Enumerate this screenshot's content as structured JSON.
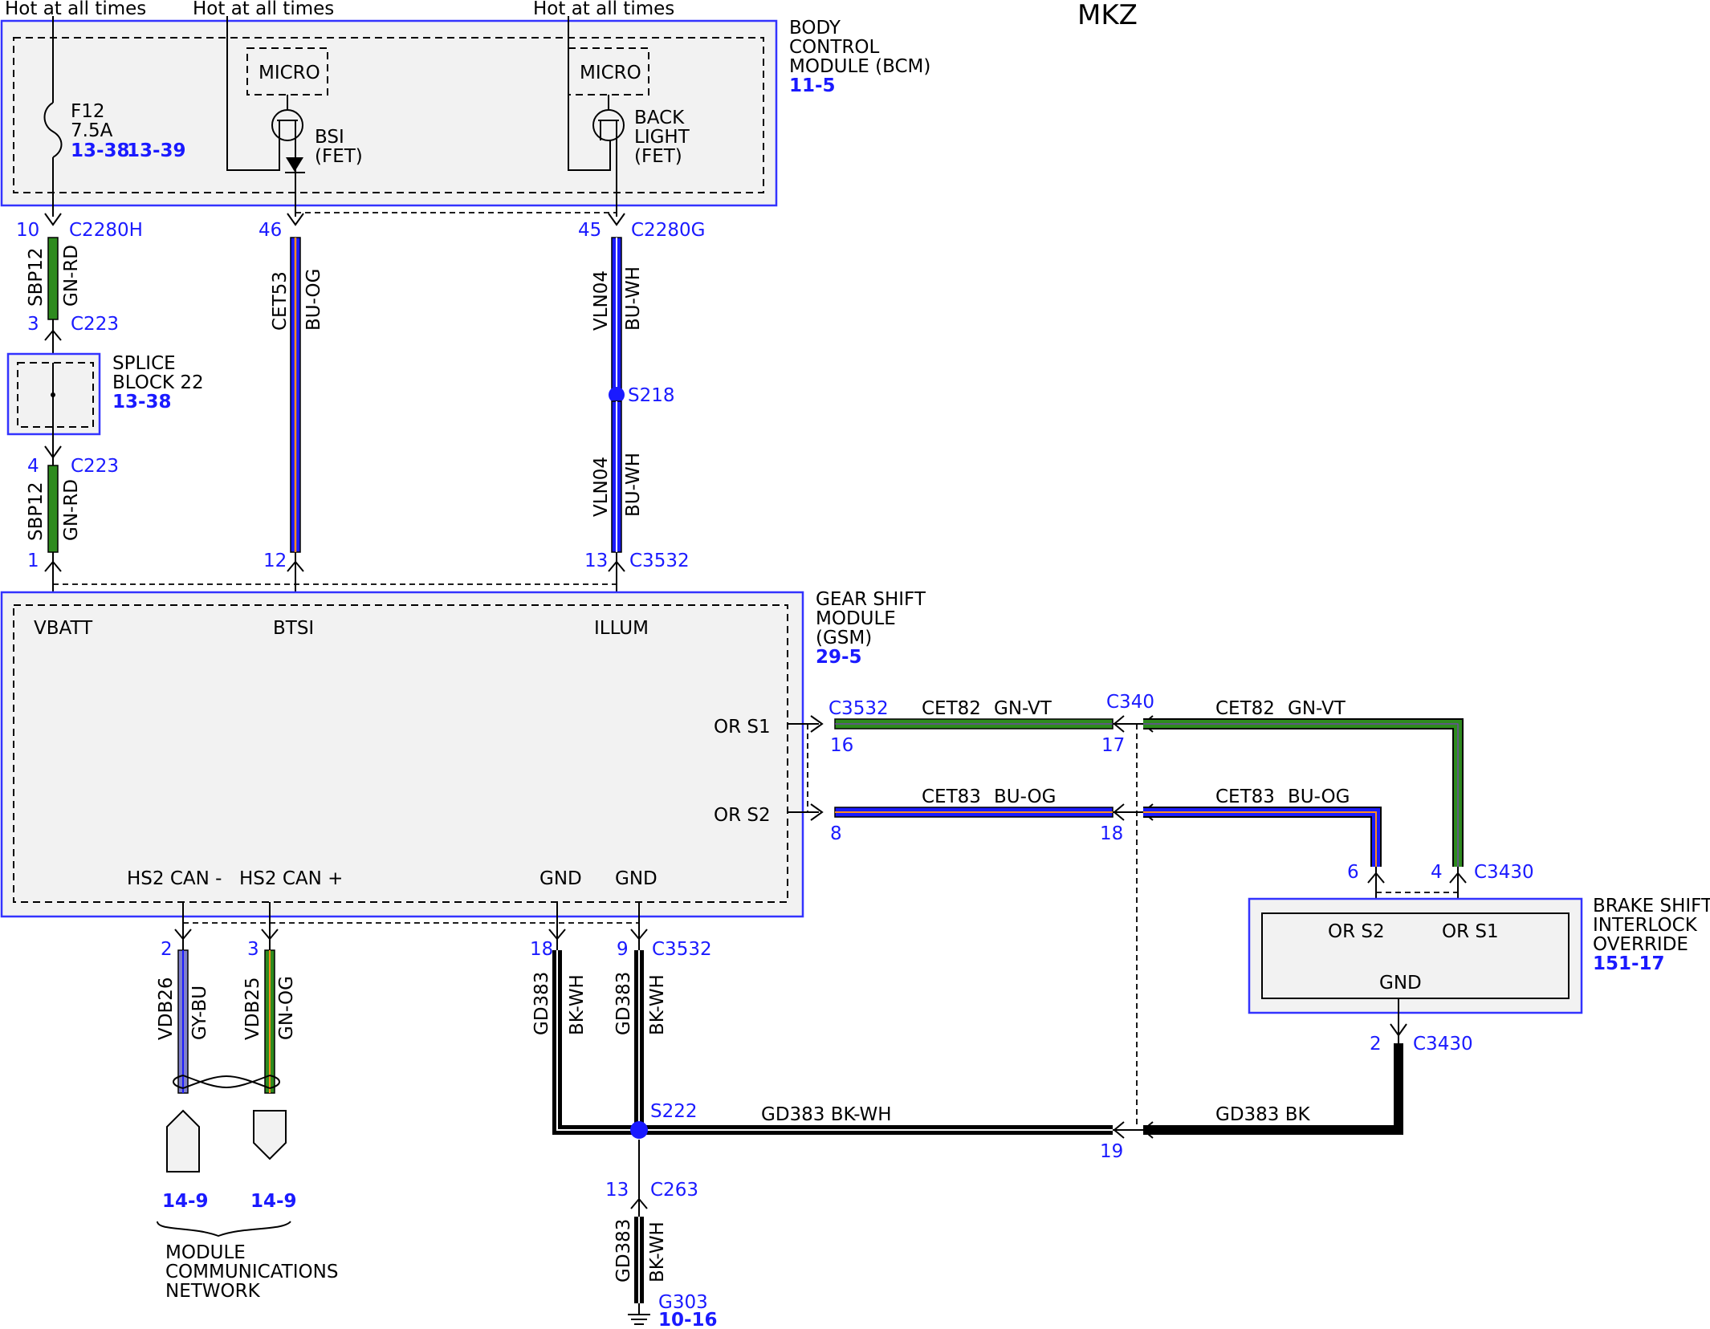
{
  "title": "MKZ",
  "colors": {
    "module_border": "#3333ff",
    "reference_text": "#1a1aff",
    "wire_green": "#2e8b1e",
    "wire_blue": "#1a1aff",
    "wire_gray_blue": "#7f7fc8",
    "wire_black": "#000000",
    "module_fill": "#f2f2f2"
  },
  "power_labels": [
    "Hot at all times",
    "Hot at all times",
    "Hot at all times"
  ],
  "bcm": {
    "name_lines": [
      "BODY",
      "CONTROL",
      "MODULE (BCM)"
    ],
    "ref": "11-5",
    "fuse": {
      "name": "F12",
      "rating": "7.5A",
      "ref1": "13-38",
      "ref2": "13-39"
    },
    "micro1": "MICRO",
    "micro2": "MICRO",
    "bsi": [
      "BSI",
      "(FET)"
    ],
    "backlight": [
      "BACK",
      "LIGHT",
      "(FET)"
    ]
  },
  "connectors": {
    "c2280h": {
      "pin": "10",
      "name": "C2280H"
    },
    "c2280g_46": {
      "pin": "46"
    },
    "c2280g": {
      "pin": "45",
      "name": "C2280G"
    },
    "c223_top": {
      "pin": "3",
      "name": "C223"
    },
    "c223_bottom": {
      "pin": "4",
      "name": "C223"
    },
    "gsm_top_1": {
      "pin": "1"
    },
    "gsm_top_12": {
      "pin": "12"
    },
    "gsm_top_13": {
      "pin": "13",
      "name": "C3532"
    },
    "or_s1": {
      "pin": "16",
      "name": "C3532"
    },
    "or_s2": {
      "pin": "8"
    },
    "c340_17": {
      "pin": "17",
      "name": "C340"
    },
    "c340_18": {
      "pin": "18"
    },
    "c340_19": {
      "pin": "19"
    },
    "bsio_6": {
      "pin": "6"
    },
    "bsio_4": {
      "pin": "4",
      "name": "C3430"
    },
    "bsio_2": {
      "pin": "2",
      "name": "C3430"
    },
    "gsm_bot_2": {
      "pin": "2"
    },
    "gsm_bot_3": {
      "pin": "3"
    },
    "gsm_bot_18": {
      "pin": "18"
    },
    "gsm_bot_9": {
      "pin": "9",
      "name": "C3532"
    },
    "c263": {
      "pin": "13",
      "name": "C263"
    }
  },
  "wires": {
    "sbp12_top": {
      "circuit": "SBP12",
      "color": "GN-RD"
    },
    "sbp12_bottom": {
      "circuit": "SBP12",
      "color": "GN-RD"
    },
    "cet53": {
      "circuit": "CET53",
      "color": "BU-OG"
    },
    "vln04_top": {
      "circuit": "VLN04",
      "color": "BU-WH"
    },
    "vln04_bottom": {
      "circuit": "VLN04",
      "color": "BU-WH"
    },
    "cet82_left": {
      "circuit": "CET82",
      "color": "GN-VT"
    },
    "cet82_right": {
      "circuit": "CET82",
      "color": "GN-VT"
    },
    "cet83_left": {
      "circuit": "CET83",
      "color": "BU-OG"
    },
    "cet83_right": {
      "circuit": "CET83",
      "color": "BU-OG"
    },
    "vdb26": {
      "circuit": "VDB26",
      "color": "GY-BU"
    },
    "vdb25": {
      "circuit": "VDB25",
      "color": "GN-OG"
    },
    "gd383_a": {
      "circuit": "GD383",
      "color": "BK-WH"
    },
    "gd383_b": {
      "circuit": "GD383",
      "color": "BK-WH"
    },
    "gd383_bottom": {
      "circuit": "GD383",
      "color": "BK-WH"
    },
    "gd383_horiz": "GD383 BK-WH",
    "gd383_bk": "GD383 BK"
  },
  "splices": {
    "s218": "S218",
    "s222": "S222"
  },
  "splice_block": {
    "name_lines": [
      "SPLICE",
      "BLOCK 22"
    ],
    "ref": "13-38"
  },
  "gsm": {
    "name_lines": [
      "GEAR SHIFT",
      "MODULE",
      "(GSM)"
    ],
    "ref": "29-5",
    "pins": {
      "vbatt": "VBATT",
      "btsi": "BTSI",
      "illum": "ILLUM",
      "or_s1": "OR S1",
      "or_s2": "OR S2",
      "can_minus": "HS2 CAN -",
      "can_plus": "HS2 CAN +",
      "gnd1": "GND",
      "gnd2": "GND"
    }
  },
  "bsio": {
    "name_lines": [
      "BRAKE SHIFT",
      "INTERLOCK",
      "OVERRIDE"
    ],
    "ref": "151-17",
    "pins": {
      "or_s2": "OR S2",
      "or_s1": "OR S1",
      "gnd": "GND"
    }
  },
  "network": {
    "ref1": "14-9",
    "ref2": "14-9",
    "label_lines": [
      "MODULE",
      "COMMUNICATIONS",
      "NETWORK"
    ]
  },
  "ground": {
    "name": "G303",
    "ref": "10-16"
  }
}
